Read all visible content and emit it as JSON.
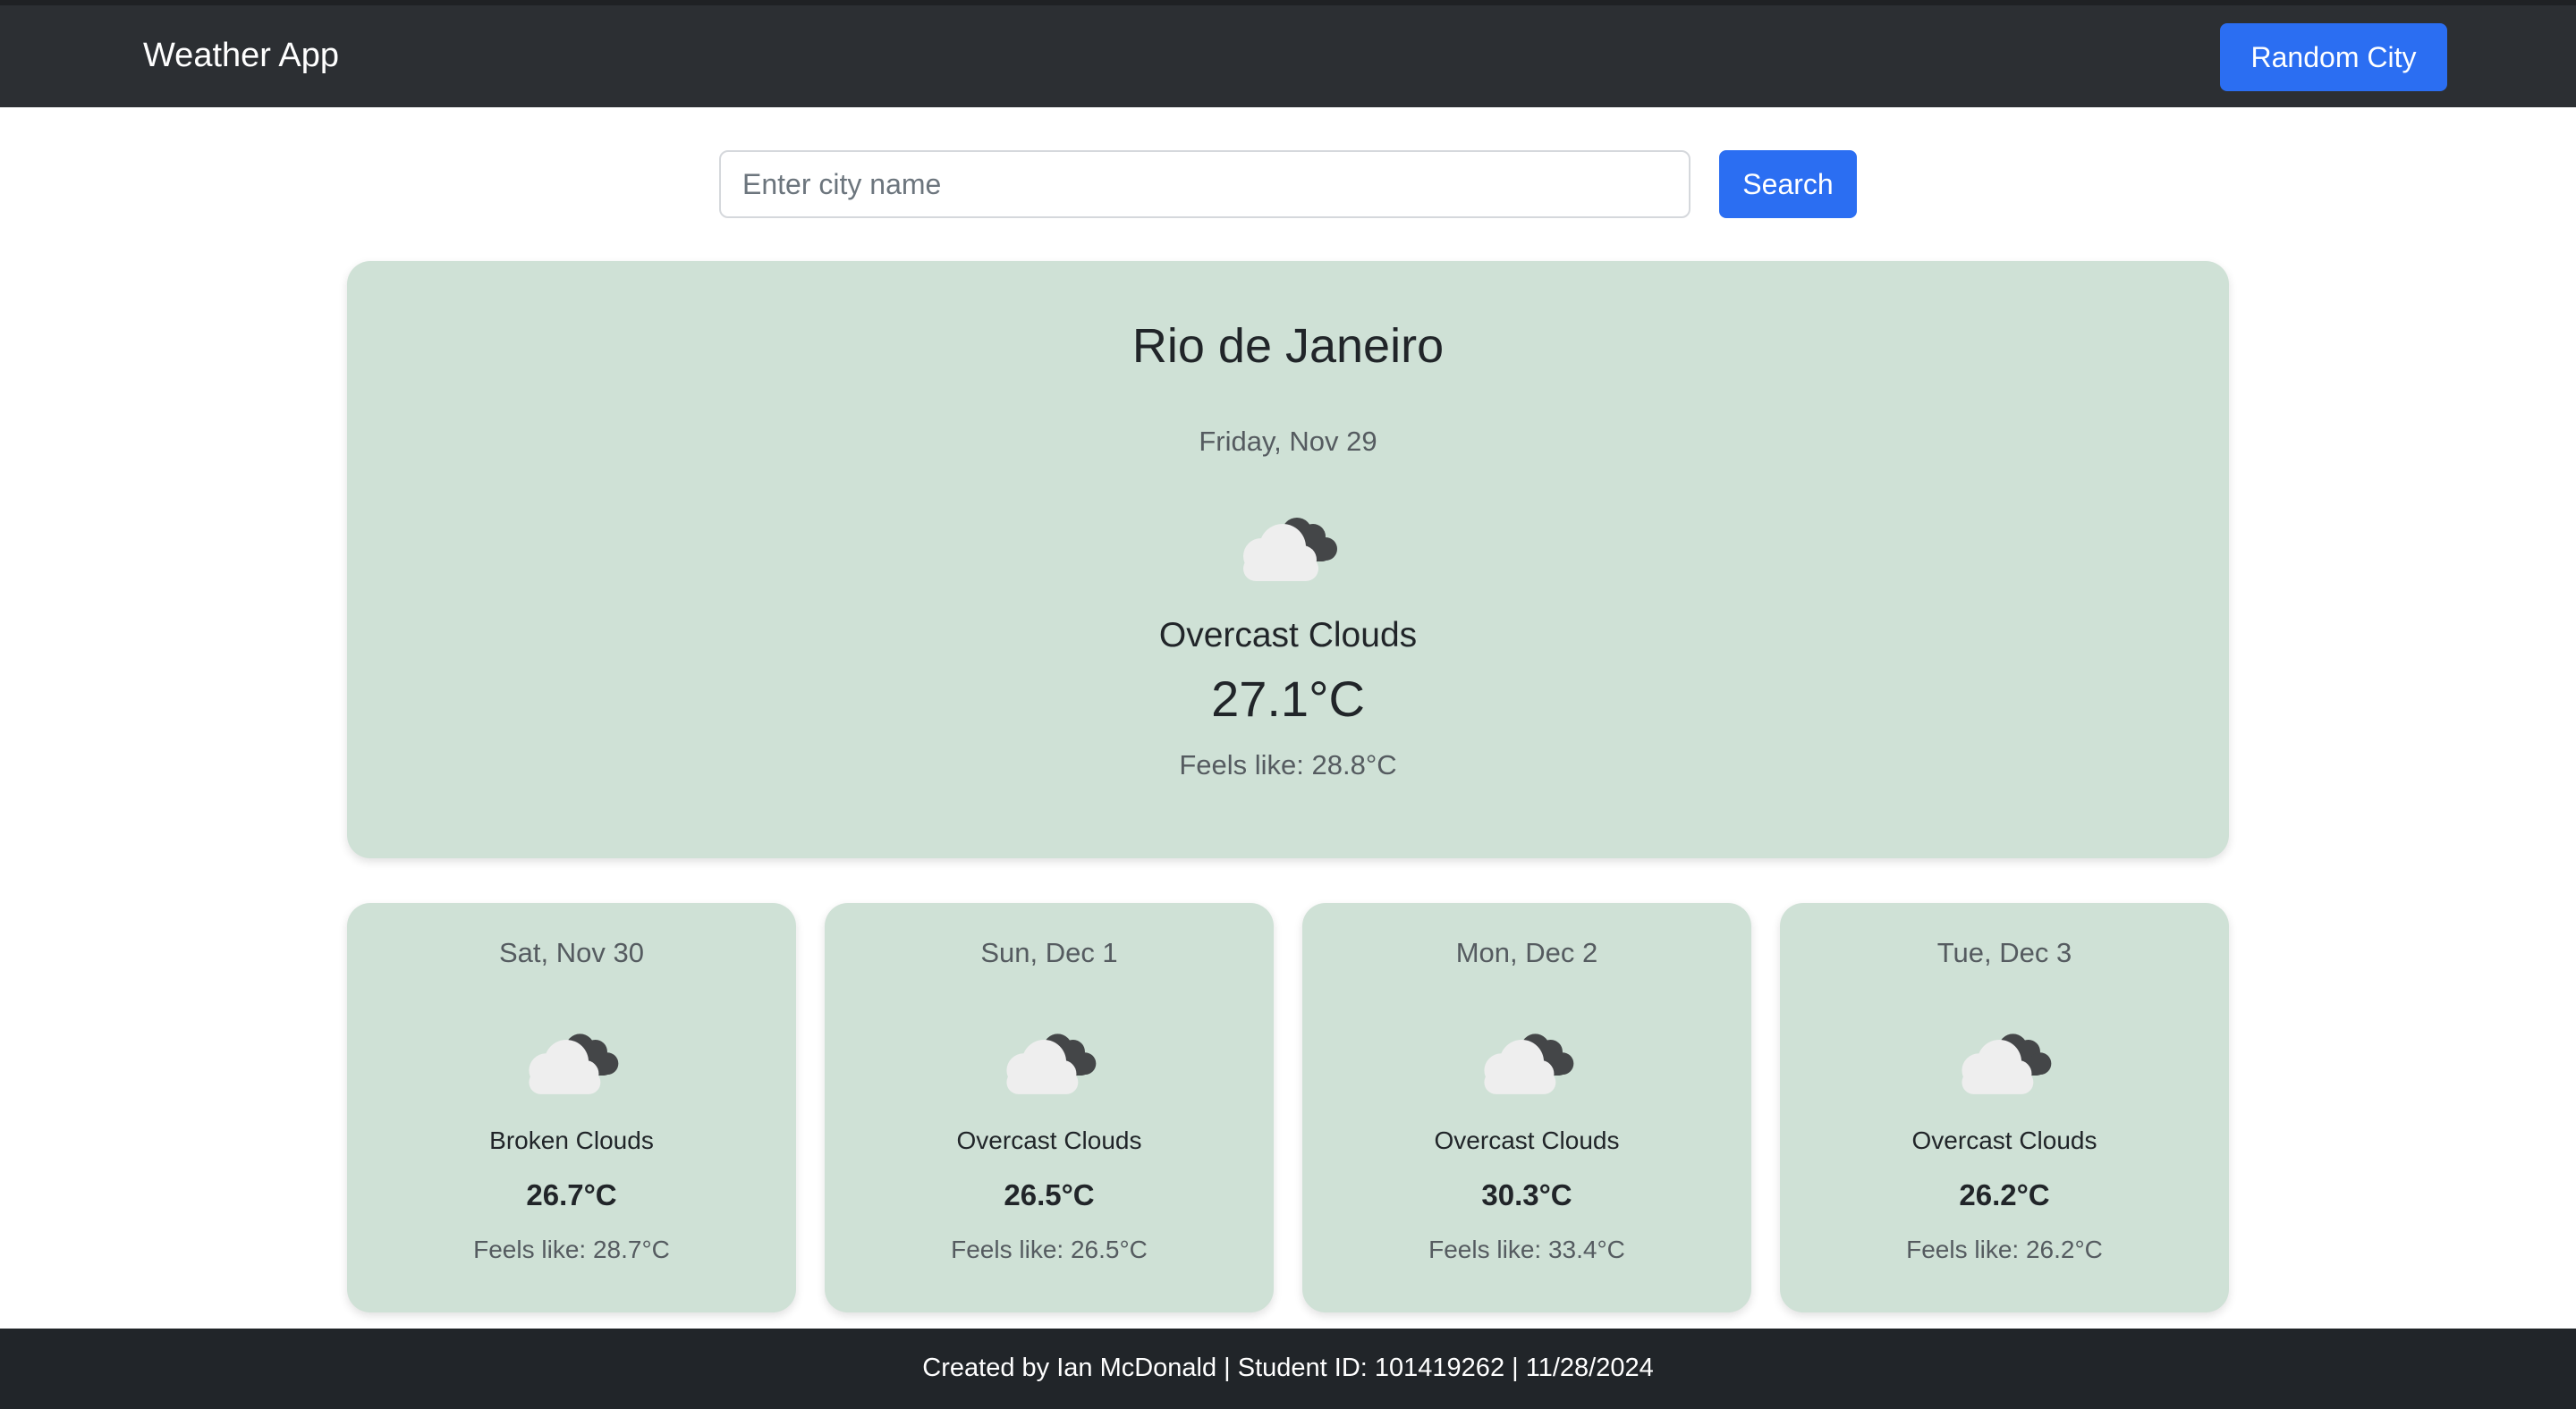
{
  "navbar": {
    "brand": "Weather App",
    "random_city_label": "Random City"
  },
  "search": {
    "placeholder": "Enter city name",
    "value": "",
    "button_label": "Search"
  },
  "current": {
    "city": "Rio de Janeiro",
    "date": "Friday, Nov 29",
    "icon": "overcast-clouds-icon",
    "description": "Overcast Clouds",
    "temperature": "27.1°C",
    "feels_like": "Feels like: 28.8°C"
  },
  "forecast": [
    {
      "date": "Sat, Nov 30",
      "icon": "broken-clouds-icon",
      "description": "Broken Clouds",
      "temperature": "26.7°C",
      "feels_like": "Feels like: 28.7°C"
    },
    {
      "date": "Sun, Dec 1",
      "icon": "overcast-clouds-icon",
      "description": "Overcast Clouds",
      "temperature": "26.5°C",
      "feels_like": "Feels like: 26.5°C"
    },
    {
      "date": "Mon, Dec 2",
      "icon": "overcast-clouds-icon",
      "description": "Overcast Clouds",
      "temperature": "30.3°C",
      "feels_like": "Feels like: 33.4°C"
    },
    {
      "date": "Tue, Dec 3",
      "icon": "overcast-clouds-icon",
      "description": "Overcast Clouds",
      "temperature": "26.2°C",
      "feels_like": "Feels like: 26.2°C"
    }
  ],
  "footer": {
    "text": "Created by Ian McDonald | Student ID: 101419262 | 11/28/2024"
  },
  "colors": {
    "navbar_bg": "#2c2f33",
    "accent_blue": "#2b6ef2",
    "card_bg": "#cfe1d6",
    "footer_bg": "#212529"
  }
}
